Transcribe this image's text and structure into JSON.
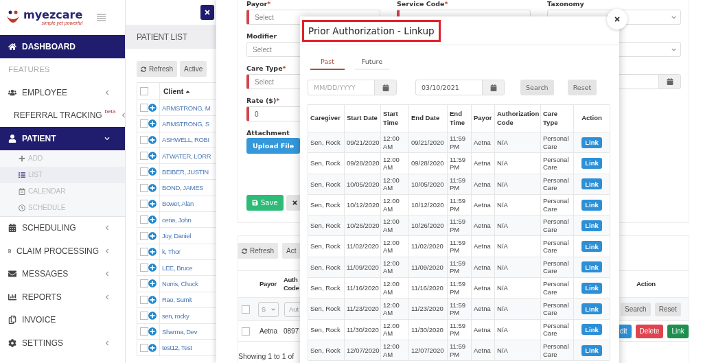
{
  "sidebar": {
    "logo": {
      "name": "myezcare",
      "tagline": "simple yet powerful"
    },
    "items": [
      {
        "label": "DASHBOARD",
        "kind": "item",
        "selected": true
      },
      {
        "label": "FEATURES",
        "kind": "heading"
      },
      {
        "label": "EMPLOYEE",
        "kind": "item",
        "selected": false,
        "expanded": false
      },
      {
        "label": "REFERRAL TRACKING",
        "kind": "item",
        "selected": false,
        "expanded": false,
        "badge": "beta"
      },
      {
        "label": "PATIENT",
        "kind": "item",
        "selected": true,
        "expanded": true,
        "children": [
          {
            "label": "ADD",
            "selected": false
          },
          {
            "label": "LIST",
            "selected": true
          },
          {
            "label": "CALENDAR",
            "selected": false
          },
          {
            "label": "SCHEDULE",
            "selected": false
          }
        ]
      },
      {
        "label": "SCHEDULING",
        "kind": "item",
        "selected": false,
        "expanded": false
      },
      {
        "label": "CLAIM PROCESSING",
        "kind": "item",
        "selected": false,
        "expanded": false
      },
      {
        "label": "MESSAGES",
        "kind": "item",
        "selected": false,
        "expanded": false
      },
      {
        "label": "REPORTS",
        "kind": "item",
        "selected": false,
        "expanded": false
      },
      {
        "label": "INVOICE",
        "kind": "item",
        "selected": false
      },
      {
        "label": "SETTINGS",
        "kind": "item",
        "selected": false,
        "expanded": false
      }
    ]
  },
  "patient_list": {
    "title": "PATIENT LIST",
    "select_all": {
      "checked": false
    },
    "buttons": [
      {
        "label": "Refresh",
        "kind": "refresh"
      },
      {
        "label": "Active",
        "kind": "plain"
      }
    ],
    "column": "Client",
    "rows": [
      {
        "client": "ARMSTRONG, M",
        "checked": false
      },
      {
        "client": "ARMSTRONG, S",
        "checked": false
      },
      {
        "client": "ASHWELL, ROBI",
        "checked": false
      },
      {
        "client": "ATWATER, LORR",
        "checked": false
      },
      {
        "client": "BEIBER, JUSTIN",
        "checked": false
      },
      {
        "client": "BOND, JAMES",
        "checked": false
      },
      {
        "client": "Bower, Alan",
        "checked": false
      },
      {
        "client": "cena, John",
        "checked": false
      },
      {
        "client": "Joy, Daniel",
        "checked": false
      },
      {
        "client": "k, Thor",
        "checked": false
      },
      {
        "client": "LEE, Bruce",
        "checked": false
      },
      {
        "client": "Norris, Chuck",
        "checked": false
      },
      {
        "client": "Rao, Sumit",
        "checked": false
      },
      {
        "client": "sen, rocky",
        "checked": false
      },
      {
        "client": "Sharma, Dev",
        "checked": false
      },
      {
        "client": "test12, Test",
        "checked": false
      }
    ]
  },
  "form": {
    "top": [
      {
        "label": "Payor",
        "required": true,
        "mark": "*",
        "placeholder": "Select"
      },
      {
        "label": "Service Code",
        "required": true,
        "mark": "*"
      },
      {
        "label": "Taxonomy",
        "required": false
      }
    ],
    "left": [
      {
        "label": "Modifier",
        "required": false,
        "kind": "select",
        "placeholder": "Select"
      },
      {
        "label": "Care Type",
        "required": true,
        "mark": "*",
        "kind": "select",
        "placeholder": "Select"
      },
      {
        "label": "Rate ($)",
        "required": true,
        "mark": "*",
        "kind": "input",
        "value": "0"
      }
    ],
    "right": [
      {
        "kind": "select"
      },
      {
        "kind": "date"
      }
    ],
    "attachment": {
      "label": "Attachment",
      "button": "Upload File"
    },
    "actions": [
      {
        "label": "Save",
        "kind": "save"
      },
      {
        "kind": "cancel"
      }
    ]
  },
  "list": {
    "buttons": [
      {
        "label": "Refresh",
        "kind": "refresh"
      },
      {
        "label": "Act",
        "kind": "plain"
      }
    ],
    "columns": [
      "Payor",
      "Auth Code",
      "Action"
    ],
    "filter": {
      "checked": false,
      "payor": "S",
      "auth_placeholder": "Aut",
      "buttons": [
        "Search",
        "Reset"
      ]
    },
    "rows": [
      {
        "checked": false,
        "payor": "Aetna",
        "auth_code": "0897",
        "actions": [
          {
            "label": "dit",
            "kind": "edit"
          },
          {
            "label": "Delete",
            "kind": "delete"
          },
          {
            "label": "Link",
            "kind": "link"
          }
        ]
      }
    ],
    "footer": "Showing 1 to 1 of"
  },
  "modal": {
    "title": "Prior Authorization - Linkup",
    "tabs": [
      {
        "label": "Past",
        "selected": true
      },
      {
        "label": "Future",
        "selected": false
      }
    ],
    "from": {
      "placeholder": "MM/DD/YYYY"
    },
    "to": {
      "value": "03/10/2021"
    },
    "buttons": [
      "Search",
      "Reset"
    ],
    "columns": [
      "Caregiver",
      "Start Date",
      "Start Time",
      "End Date",
      "End Time",
      "Payor",
      "Authorization Code",
      "Care Type",
      "Action"
    ],
    "rows": [
      [
        "Sen, Rock",
        "09/21/2020",
        "12:00 AM",
        "09/21/2020",
        "11:59 PM",
        "Aetna",
        "N/A",
        "Personal Care",
        "Link"
      ],
      [
        "Sen, Rock",
        "09/28/2020",
        "12:00 AM",
        "09/28/2020",
        "11:59 PM",
        "Aetna",
        "N/A",
        "Personal Care",
        "Link"
      ],
      [
        "Sen, Rock",
        "10/05/2020",
        "12:00 AM",
        "10/05/2020",
        "11:59 PM",
        "Aetna",
        "N/A",
        "Personal Care",
        "Link"
      ],
      [
        "Sen, Rock",
        "10/12/2020",
        "12:00 AM",
        "10/12/2020",
        "11:59 PM",
        "Aetna",
        "N/A",
        "Personal Care",
        "Link"
      ],
      [
        "Sen, Rock",
        "10/26/2020",
        "12:00 AM",
        "10/26/2020",
        "11:59 PM",
        "Aetna",
        "N/A",
        "Personal Care",
        "Link"
      ],
      [
        "Sen, Rock",
        "11/02/2020",
        "12:00 AM",
        "11/02/2020",
        "11:59 PM",
        "Aetna",
        "N/A",
        "Personal Care",
        "Link"
      ],
      [
        "Sen, Rock",
        "11/09/2020",
        "12:00 AM",
        "11/09/2020",
        "11:59 PM",
        "Aetna",
        "N/A",
        "Personal Care",
        "Link"
      ],
      [
        "Sen, Rock",
        "11/16/2020",
        "12:00 AM",
        "11/16/2020",
        "11:59 PM",
        "Aetna",
        "N/A",
        "Personal Care",
        "Link"
      ],
      [
        "Sen, Rock",
        "11/23/2020",
        "12:00 AM",
        "11/23/2020",
        "11:59 PM",
        "Aetna",
        "N/A",
        "Personal Care",
        "Link"
      ],
      [
        "Sen, Rock",
        "11/30/2020",
        "12:00 AM",
        "11/30/2020",
        "11:59 PM",
        "Aetna",
        "N/A",
        "Personal Care",
        "Link"
      ],
      [
        "Sen, Rock",
        "12/07/2020",
        "12:00 AM",
        "12/07/2020",
        "11:59 PM",
        "Aetna",
        "N/A",
        "Personal Care",
        "Link"
      ]
    ]
  }
}
